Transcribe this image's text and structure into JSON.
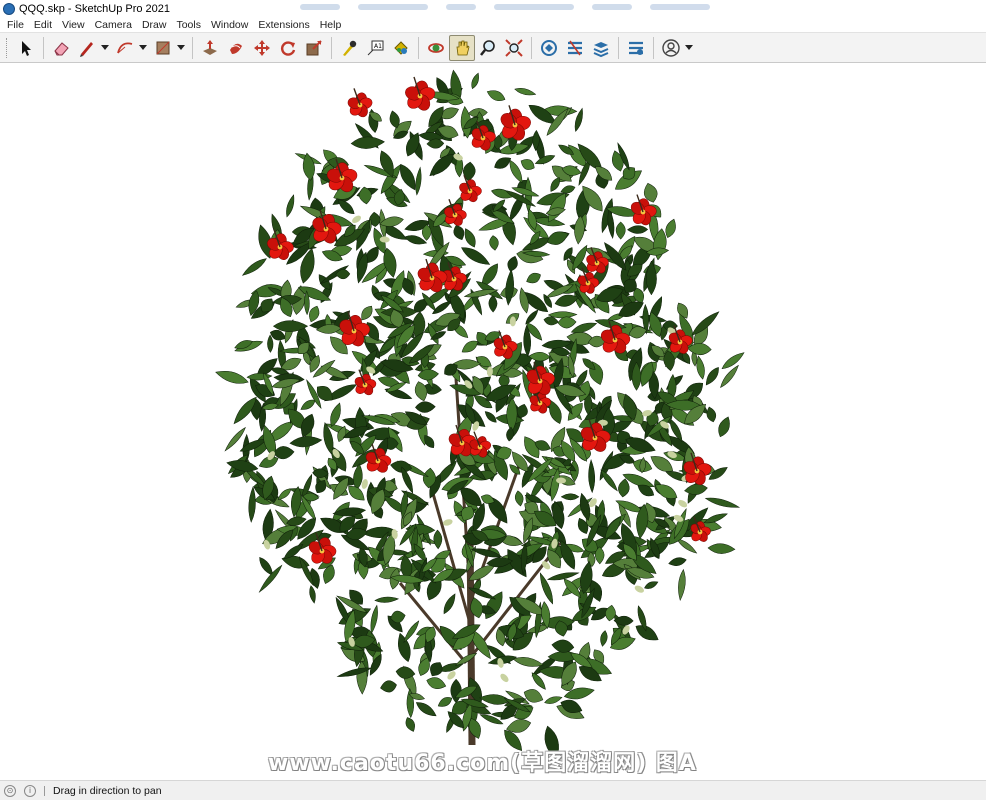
{
  "window": {
    "title": "QQQ.skp - SketchUp Pro 2021"
  },
  "menu": [
    "File",
    "Edit",
    "View",
    "Camera",
    "Draw",
    "Tools",
    "Window",
    "Extensions",
    "Help"
  ],
  "toolbar": {
    "tools": [
      {
        "name": "select-tool-icon"
      },
      {
        "name": "eraser-tool-icon"
      },
      {
        "name": "line-tool-icon"
      },
      {
        "name": "arc-tool-icon"
      },
      {
        "name": "shape-tool-icon"
      },
      {
        "name": "push-pull-tool-icon"
      },
      {
        "name": "follow-me-tool-icon"
      },
      {
        "name": "move-tool-icon"
      },
      {
        "name": "rotate-tool-icon"
      },
      {
        "name": "scale-tool-icon"
      },
      {
        "name": "tape-measure-tool-icon"
      },
      {
        "name": "text-tool-icon"
      },
      {
        "name": "paint-bucket-tool-icon"
      },
      {
        "name": "orbit-tool-icon"
      },
      {
        "name": "pan-tool-icon",
        "active": true
      },
      {
        "name": "zoom-tool-icon"
      },
      {
        "name": "zoom-extents-tool-icon"
      },
      {
        "name": "3d-warehouse-icon"
      },
      {
        "name": "extension-warehouse-icon"
      },
      {
        "name": "layout-send-icon"
      },
      {
        "name": "extension-manager-icon"
      },
      {
        "name": "account-icon"
      }
    ]
  },
  "viewport": {
    "model": "flowering-shrub",
    "watermark": "www.caotu66.com(草图溜溜网) 图A",
    "colors": {
      "leaf_dark": "#1f3d14",
      "leaf_mid": "#3a6b25",
      "flower": "#e3170f",
      "trunk": "#4a3a2a"
    }
  },
  "status": {
    "text": "Drag in direction to pan"
  }
}
